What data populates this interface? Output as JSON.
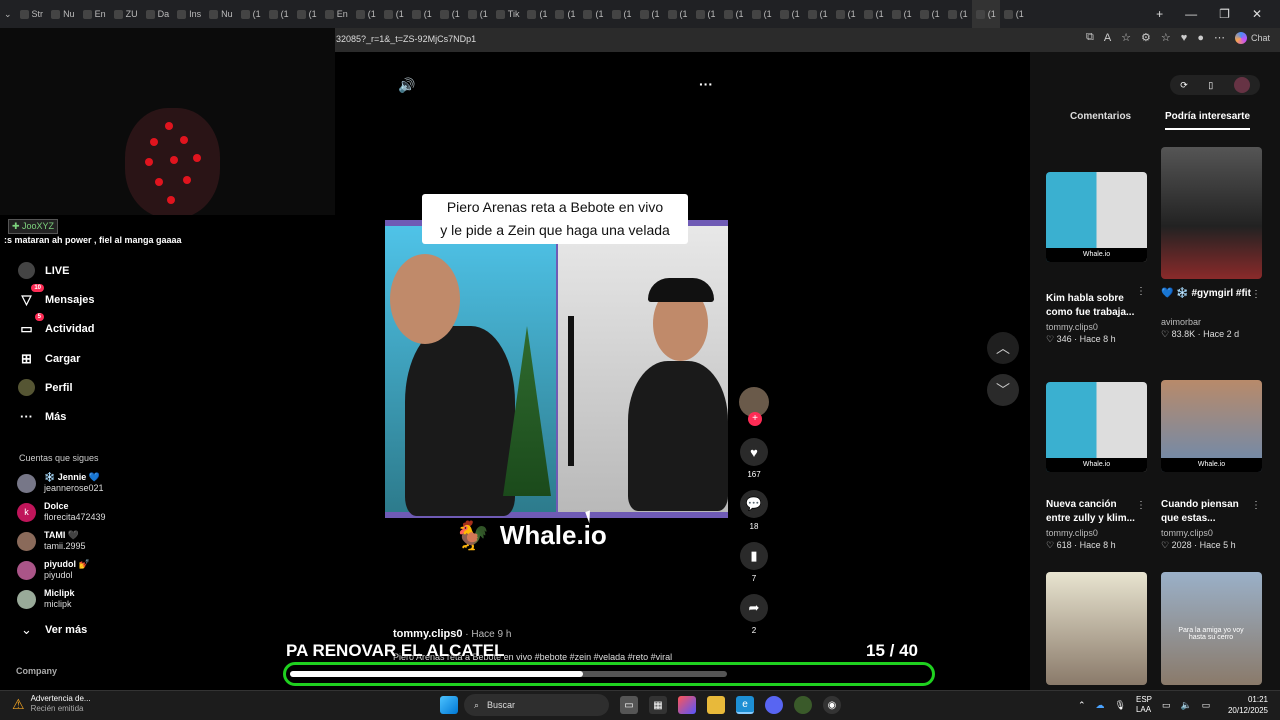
{
  "browser": {
    "tabs": [
      "Str",
      "Nu",
      "En",
      "ZU",
      "Da",
      "Ins",
      "Nu",
      "(1",
      "(1",
      "(1",
      "En",
      "(1",
      "(1",
      "(1",
      "(1",
      "(1",
      "Tik",
      "(1",
      "(1",
      "(1",
      "(1",
      "(1",
      "(1",
      "(1",
      "(1",
      "(1",
      "(1",
      "(1",
      "(1",
      "(1",
      "(1",
      "(1",
      "(1",
      "(1",
      "(1"
    ],
    "url": "32085?_r=1&_t=ZS-92MjCs7NDp1",
    "chat_label": "Chat",
    "new_tab": "+",
    "win_min": "—",
    "win_max": "❐",
    "win_close": "✕"
  },
  "stream_overlay": {
    "chat_user": "✚ JooXYZ",
    "chat_message": ":s mataran ah power , fiel al manga gaaaa",
    "bottom_title": "PA RENOVAR EL ALCATEL",
    "counter": "15  / 40",
    "progress_fraction": 0.67,
    "progress_color": "#1fd11f"
  },
  "sidebar": {
    "nav": [
      {
        "label": "LIVE",
        "icon": "live-icon"
      },
      {
        "label": "Mensajes",
        "icon": "messages-icon",
        "badge": "10"
      },
      {
        "label": "Actividad",
        "icon": "activity-icon",
        "badge": "5"
      },
      {
        "label": "Cargar",
        "icon": "upload-icon"
      },
      {
        "label": "Perfil",
        "icon": "profile-icon"
      },
      {
        "label": "Más",
        "icon": "more-icon"
      }
    ],
    "following_header": "Cuentas que sigues",
    "following": [
      {
        "name": "❄️ Jennie 💙",
        "handle": "jeannerose021"
      },
      {
        "name": "Dolce",
        "handle": "florecita472439",
        "initial": "k"
      },
      {
        "name": "TAMI 🖤",
        "handle": "tamii.2995"
      },
      {
        "name": "piyudol 💅",
        "handle": "piyudol"
      },
      {
        "name": "Miclipk",
        "handle": "miclipk"
      }
    ],
    "see_more": "Ver más",
    "company": "Company"
  },
  "video": {
    "caption_line1": "Piero Arenas reta a Bebote en vivo",
    "caption_line2": "y le pide a Zein que haga una velada",
    "watermark": "Whale.io",
    "author": "tommy.clips0",
    "time_ago": " · Hace 9 h",
    "description": "Piero Arenas reta a Bebote en vivo #bebote #zein #velada #reto #viral",
    "likes": "167",
    "comments": "18",
    "saves": "7",
    "shares": "2"
  },
  "right_panel": {
    "tab_comments": "Comentarios",
    "tab_suggested": "Podría interesarte",
    "cards": [
      {
        "title": "Kim habla sobre como fue trabaja...",
        "author": "tommy.clips0",
        "stats": "♡ 346 · Hace 8 h",
        "thumb_text": "Whale.io"
      },
      {
        "title": "💙 ❄️ #gymgirl #fit",
        "author": "avimorbar",
        "stats": "♡ 83.8K · Hace 2 d",
        "thumb_text": ""
      },
      {
        "title": "Nueva canción entre zully y klim...",
        "author": "tommy.clips0",
        "stats": "♡ 618 · Hace 8 h",
        "thumb_text": "Whale.io"
      },
      {
        "title": "Cuando piensan que estas...",
        "author": "tommy.clips0",
        "stats": "♡ 2028 · Hace 5 h",
        "thumb_text": "Whale.io"
      },
      {
        "title": "",
        "author": "",
        "stats": "",
        "thumb_text": ""
      },
      {
        "title": "",
        "author": "",
        "stats": "",
        "thumb_text": "Para la amiga yo voy hasta su cerro"
      }
    ]
  },
  "taskbar": {
    "notif_title": "Advertencia de...",
    "notif_sub": "Recién emitida",
    "search_placeholder": "Buscar",
    "lang1": "ESP",
    "lang2": "LAA",
    "time": "01:21",
    "date": "20/12/2025"
  }
}
